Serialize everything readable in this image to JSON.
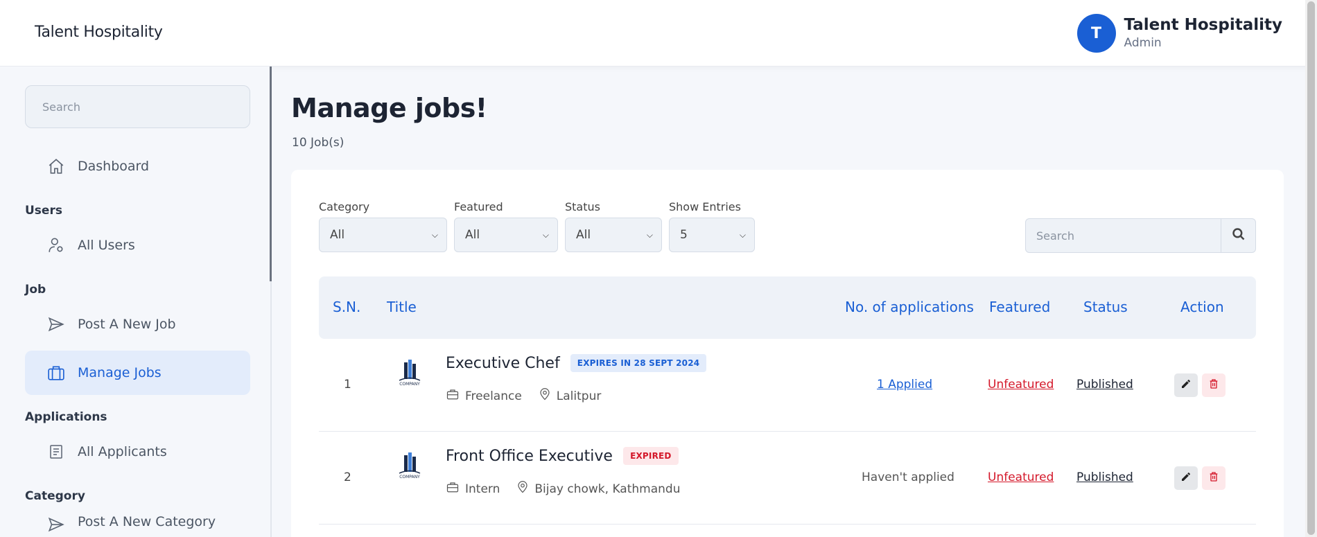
{
  "app": {
    "brand": "Talent Hospitality",
    "user": {
      "initial": "T",
      "name": "Talent Hospitality",
      "role": "Admin"
    }
  },
  "sidebar": {
    "search_placeholder": "Search",
    "dashboard": {
      "label": "Dashboard",
      "icon": "home-icon"
    },
    "sections": [
      {
        "title": "Users",
        "items": [
          {
            "label": "All Users",
            "icon": "user-gear-icon"
          }
        ]
      },
      {
        "title": "Job",
        "items": [
          {
            "label": "Post A New Job",
            "icon": "send-icon"
          },
          {
            "label": "Manage Jobs",
            "icon": "briefcase-icon",
            "active": true
          }
        ]
      },
      {
        "title": "Applications",
        "items": [
          {
            "label": "All Applicants",
            "icon": "document-icon"
          }
        ]
      },
      {
        "title": "Category",
        "items": [
          {
            "label": "Post A New Category",
            "icon": "send-icon"
          }
        ]
      }
    ]
  },
  "main": {
    "title": "Manage jobs!",
    "subtitle": "10 Job(s)",
    "filters": [
      {
        "label": "Category",
        "value": "All"
      },
      {
        "label": "Featured",
        "value": "All"
      },
      {
        "label": "Status",
        "value": "All"
      },
      {
        "label": "Show Entries",
        "value": "5"
      }
    ],
    "search_placeholder": "Search",
    "columns": [
      "S.N.",
      "Title",
      "No. of applications",
      "Featured",
      "Status",
      "Action"
    ],
    "rows": [
      {
        "sn": "1",
        "title": "Executive Chef",
        "badge": "EXPIRES IN 28 SEPT 2024",
        "badge_type": "blue",
        "type": "Freelance",
        "location": "Lalitpur",
        "applications": "1 Applied",
        "featured": "Unfeatured",
        "status": "Published"
      },
      {
        "sn": "2",
        "title": "Front Office Executive",
        "badge": "EXPIRED",
        "badge_type": "red",
        "type": "Intern",
        "location": "Bijay chowk, Kathmandu",
        "applications": "Haven't applied",
        "featured": "Unfeatured",
        "status": "Published"
      }
    ],
    "logo_text": "COMPANY"
  },
  "colors": {
    "accent": "#1a5fd4",
    "danger": "#d4182a",
    "background": "#f5f7fb"
  }
}
